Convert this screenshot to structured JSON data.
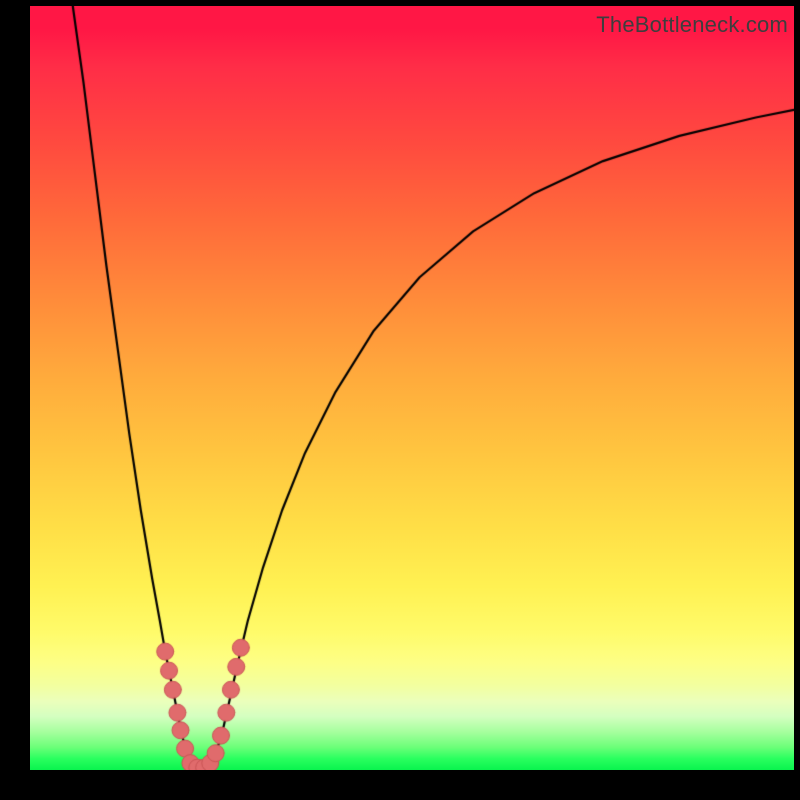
{
  "watermark": "TheBottleneck.com",
  "colors": {
    "frame": "#000000",
    "curve": "#000000",
    "dot_fill": "#e06b6c",
    "dot_stroke": "#c95455"
  },
  "chart_data": {
    "type": "line",
    "title": "",
    "xlabel": "",
    "ylabel": "",
    "xlim": [
      0,
      100
    ],
    "ylim": [
      0,
      100
    ],
    "curve": {
      "note": "Bottleneck-style V curve; x in percent of width, y in percent (0 = bottom)",
      "points": [
        {
          "x": 5.6,
          "y": 100.0
        },
        {
          "x": 7.0,
          "y": 90.0
        },
        {
          "x": 8.5,
          "y": 78.0
        },
        {
          "x": 10.0,
          "y": 66.0
        },
        {
          "x": 11.5,
          "y": 55.0
        },
        {
          "x": 13.0,
          "y": 44.0
        },
        {
          "x": 14.5,
          "y": 34.0
        },
        {
          "x": 16.0,
          "y": 25.0
        },
        {
          "x": 17.0,
          "y": 19.5
        },
        {
          "x": 17.7,
          "y": 15.5
        },
        {
          "x": 18.5,
          "y": 11.5
        },
        {
          "x": 19.2,
          "y": 8.0
        },
        {
          "x": 19.8,
          "y": 5.0
        },
        {
          "x": 20.5,
          "y": 2.2
        },
        {
          "x": 21.2,
          "y": 0.8
        },
        {
          "x": 22.0,
          "y": 0.2
        },
        {
          "x": 22.8,
          "y": 0.2
        },
        {
          "x": 23.6,
          "y": 0.8
        },
        {
          "x": 24.4,
          "y": 2.4
        },
        {
          "x": 25.3,
          "y": 5.5
        },
        {
          "x": 26.2,
          "y": 9.5
        },
        {
          "x": 27.2,
          "y": 14.0
        },
        {
          "x": 28.5,
          "y": 19.5
        },
        {
          "x": 30.5,
          "y": 26.5
        },
        {
          "x": 33.0,
          "y": 34.0
        },
        {
          "x": 36.0,
          "y": 41.5
        },
        {
          "x": 40.0,
          "y": 49.5
        },
        {
          "x": 45.0,
          "y": 57.5
        },
        {
          "x": 51.0,
          "y": 64.5
        },
        {
          "x": 58.0,
          "y": 70.5
        },
        {
          "x": 66.0,
          "y": 75.5
        },
        {
          "x": 75.0,
          "y": 79.7
        },
        {
          "x": 85.0,
          "y": 83.0
        },
        {
          "x": 95.0,
          "y": 85.4
        },
        {
          "x": 100.0,
          "y": 86.4
        }
      ]
    },
    "series": [
      {
        "name": "highlight-dots",
        "points": [
          {
            "x": 17.7,
            "y": 15.5
          },
          {
            "x": 18.2,
            "y": 13.0
          },
          {
            "x": 18.7,
            "y": 10.5
          },
          {
            "x": 19.3,
            "y": 7.5
          },
          {
            "x": 19.7,
            "y": 5.2
          },
          {
            "x": 20.3,
            "y": 2.8
          },
          {
            "x": 21.0,
            "y": 0.9
          },
          {
            "x": 21.9,
            "y": 0.3
          },
          {
            "x": 22.8,
            "y": 0.3
          },
          {
            "x": 23.6,
            "y": 0.9
          },
          {
            "x": 24.3,
            "y": 2.2
          },
          {
            "x": 25.0,
            "y": 4.5
          },
          {
            "x": 25.7,
            "y": 7.5
          },
          {
            "x": 26.3,
            "y": 10.5
          },
          {
            "x": 27.0,
            "y": 13.5
          },
          {
            "x": 27.6,
            "y": 16.0
          }
        ]
      }
    ]
  }
}
